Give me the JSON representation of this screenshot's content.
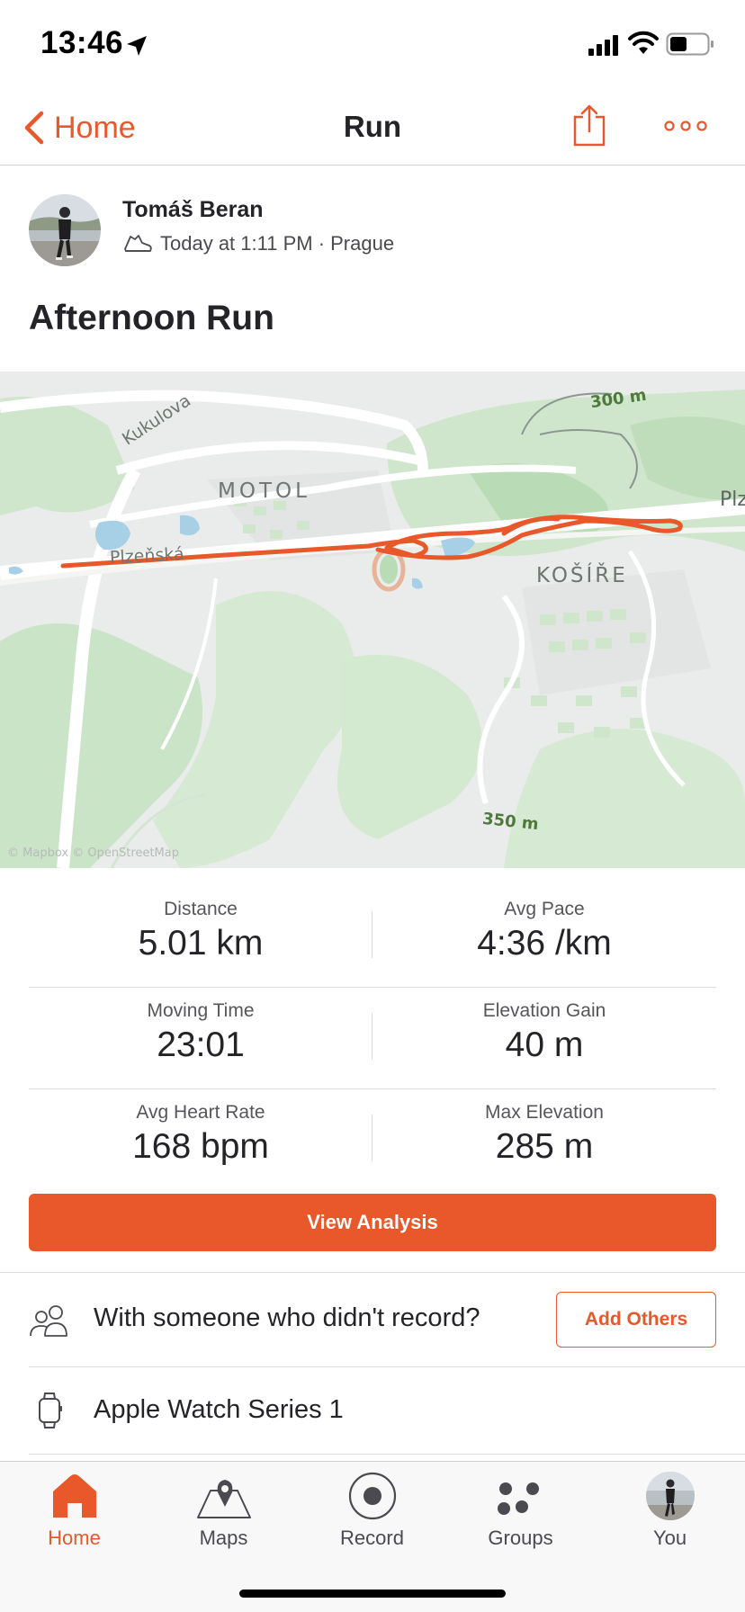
{
  "status_bar": {
    "time": "13:46"
  },
  "nav": {
    "back_label": "Home",
    "title": "Run"
  },
  "activity": {
    "athlete_name": "Tomáš Beran",
    "meta": "Today at 1:11 PM · Prague",
    "title": "Afternoon Run"
  },
  "map": {
    "labels": {
      "street_kukulova": "Kukulova",
      "district_motol": "MOTOL",
      "street_plzenska": "Plzeňská",
      "district_kosire": "KOŠÍŘE",
      "contour_300": "300 m",
      "contour_350": "350 m",
      "edge_plz": "Plz",
      "attribution": "© Mapbox © OpenStreetMap"
    },
    "route_color": "#e8582a"
  },
  "stats": [
    {
      "left": {
        "label": "Distance",
        "value": "5.01 km"
      },
      "right": {
        "label": "Avg Pace",
        "value": "4:36 /km"
      }
    },
    {
      "left": {
        "label": "Moving Time",
        "value": "23:01"
      },
      "right": {
        "label": "Elevation Gain",
        "value": "40 m"
      }
    },
    {
      "left": {
        "label": "Avg Heart Rate",
        "value": "168 bpm"
      },
      "right": {
        "label": "Max Elevation",
        "value": "285 m"
      }
    }
  ],
  "actions": {
    "view_analysis": "View Analysis",
    "with_someone": "With someone who didn't record?",
    "add_others": "Add Others",
    "device": "Apple Watch Series 1"
  },
  "tabs": [
    {
      "label": "Home",
      "icon": "home-icon",
      "active": true
    },
    {
      "label": "Maps",
      "icon": "maps-icon",
      "active": false
    },
    {
      "label": "Record",
      "icon": "record-icon",
      "active": false
    },
    {
      "label": "Groups",
      "icon": "groups-icon",
      "active": false
    },
    {
      "label": "You",
      "icon": "avatar",
      "active": false
    }
  ],
  "colors": {
    "accent": "#e8582a",
    "text": "#242428",
    "muted": "#55555a"
  }
}
